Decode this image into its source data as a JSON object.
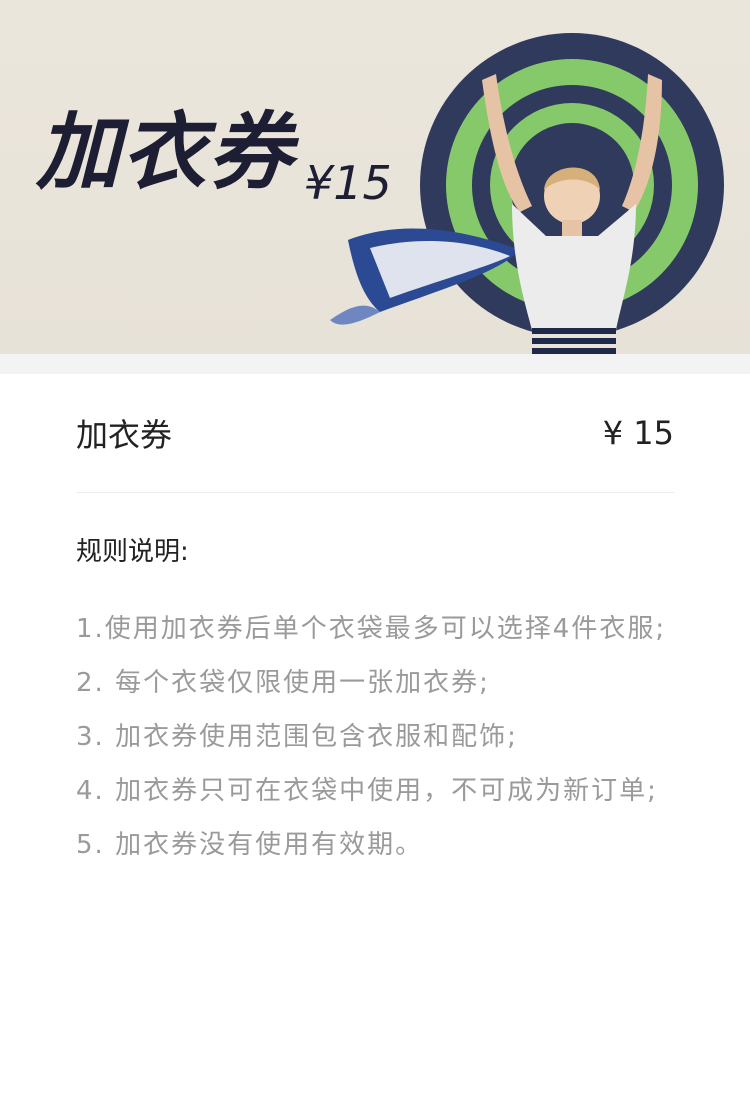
{
  "banner": {
    "title": "加衣券",
    "price": "¥15"
  },
  "coupon": {
    "name": "加衣券",
    "price": "¥ 15"
  },
  "rules": {
    "title": "规则说明:",
    "items": [
      "1.使用加衣券后单个衣袋最多可以选择4件衣服;",
      "2. 每个衣袋仅限使用一张加衣券;",
      "3. 加衣券使用范围包含衣服和配饰;",
      "4. 加衣券只可在衣袋中使用，不可成为新订单;",
      "5. 加衣券没有使用有效期。"
    ]
  },
  "colors": {
    "banner_bg": "#e9e4d9",
    "hat_green": "#86c96a",
    "hat_navy": "#2f3a5c",
    "title_text": "#1d1e33",
    "rule_text": "#9a9a9a"
  }
}
